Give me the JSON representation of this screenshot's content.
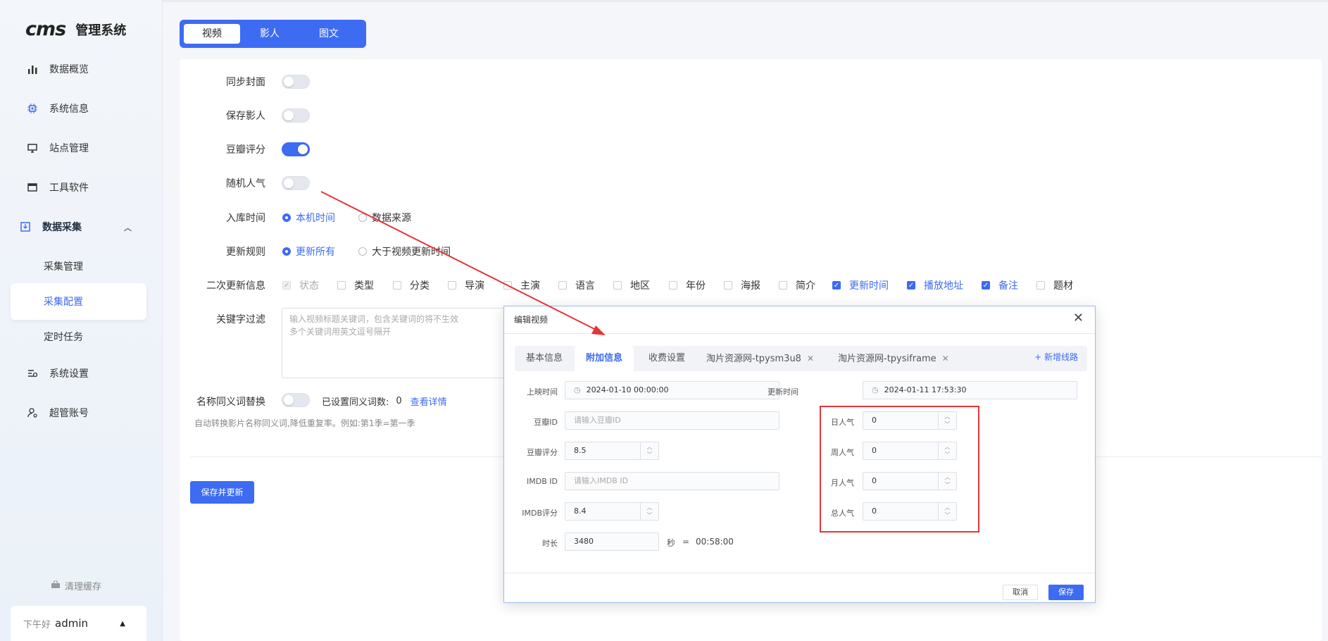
{
  "sidebar": {
    "logo_mark": "cms",
    "logo_text": "管理系统",
    "items": [
      {
        "label": "数据概览",
        "icon": "bar-chart-icon"
      },
      {
        "label": "系统信息",
        "icon": "chip-icon"
      },
      {
        "label": "站点管理",
        "icon": "monitor-icon"
      },
      {
        "label": "工具软件",
        "icon": "window-icon"
      },
      {
        "label": "数据采集",
        "icon": "download-box-icon"
      },
      {
        "label": "系统设置",
        "icon": "settings-sliders-icon"
      },
      {
        "label": "超管账号",
        "icon": "user-gear-icon"
      }
    ],
    "sub_items": [
      "采集管理",
      "采集配置",
      "定时任务"
    ],
    "clear_cache": "清理缓存",
    "greeting": "下午好",
    "username": "admin"
  },
  "tabs": [
    "视频",
    "影人",
    "图文"
  ],
  "form": {
    "sync_cover": "同步封面",
    "save_person": "保存影人",
    "douban_score": "豆瓣评分",
    "random_pop": "随机人气",
    "storage_time": "入库时间",
    "storage_opt1": "本机时间",
    "storage_opt2": "数据来源",
    "update_rule": "更新规则",
    "rule_opt1": "更新所有",
    "rule_opt2": "大于视频更新时间",
    "secondary_update": "二次更新信息",
    "checkboxes": [
      "状态",
      "类型",
      "分类",
      "导演",
      "主演",
      "语言",
      "地区",
      "年份",
      "海报",
      "简介",
      "更新时间",
      "播放地址",
      "备注",
      "题材"
    ],
    "keyword_filter": "关键字过滤",
    "keyword_placeholder_1": "输入视频标题关键词，包含关键词的将不生效",
    "keyword_placeholder_2": "多个关键词用英文逗号隔开",
    "synonym": "名称同义词替换",
    "synonym_set": "已设置同义词数:",
    "synonym_count": "0",
    "synonym_detail": "查看详情",
    "synonym_hint": "自动转换影片名称同义词,降低重复率。例如:第1季=第一季",
    "save_button": "保存并更新"
  },
  "modal": {
    "title": "编辑视频",
    "tabs": [
      "基本信息",
      "附加信息",
      "收费设置",
      "淘片资源网-tpysm3u8",
      "淘片资源网-tpysiframe"
    ],
    "add_line": "+ 新增线路",
    "release_label": "上映时间",
    "release_value": "2024-01-10 00:00:00",
    "update_label": "更新时间",
    "update_value": "2024-01-11 17:53:30",
    "douban_id_label": "豆瓣ID",
    "douban_id_placeholder": "请输入豆瓣ID",
    "douban_score_label": "豆瓣评分",
    "douban_score_value": "8.5",
    "imdb_id_label": "IMDB ID",
    "imdb_id_placeholder": "请输入IMDB ID",
    "imdb_score_label": "IMDB评分",
    "imdb_score_value": "8.4",
    "duration_label": "时长",
    "duration_value": "3480",
    "duration_unit": "秒",
    "duration_eq": "=",
    "duration_hms": "00:58:00",
    "day_pop_label": "日人气",
    "day_pop_value": "0",
    "week_pop_label": "周人气",
    "week_pop_value": "0",
    "month_pop_label": "月人气",
    "month_pop_value": "0",
    "total_pop_label": "总人气",
    "total_pop_value": "0",
    "cancel": "取消",
    "save": "保存"
  },
  "colors": {
    "accent": "#3d6bf2",
    "annotation": "#e5343a"
  }
}
